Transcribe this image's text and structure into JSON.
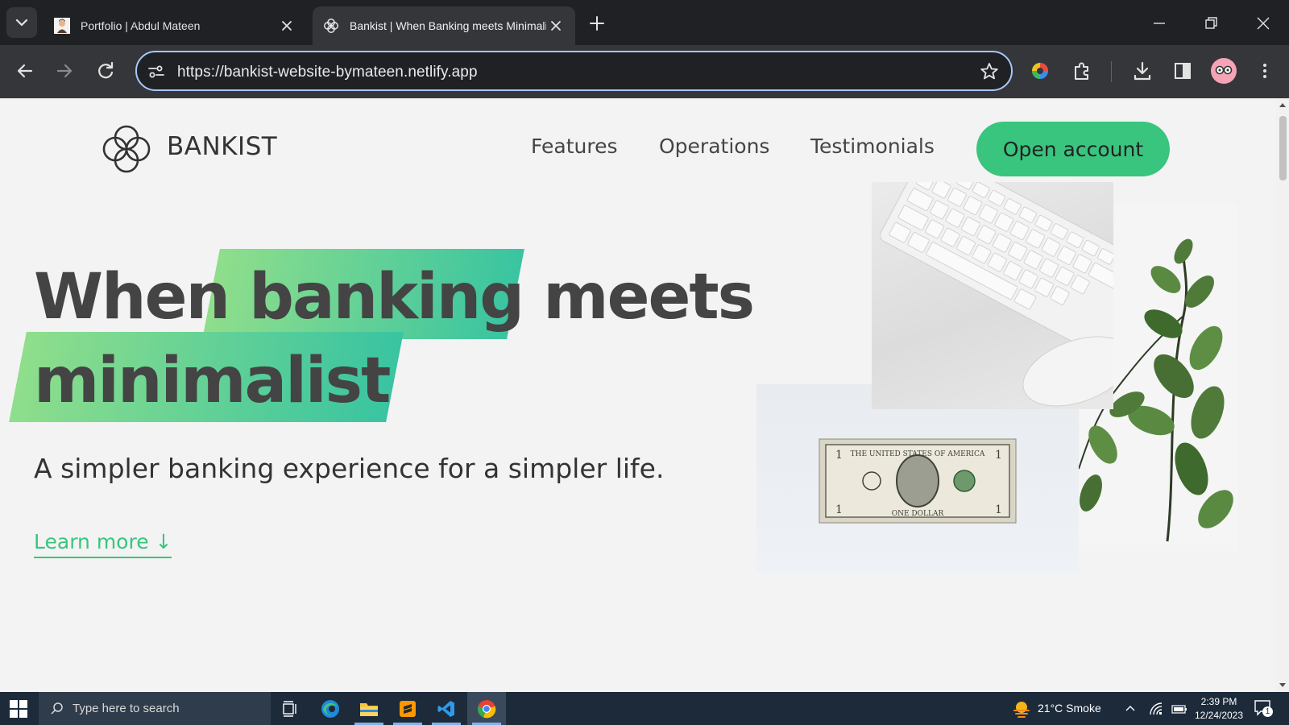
{
  "browser": {
    "tabs": [
      {
        "title": "Portfolio | Abdul Mateen",
        "active": false
      },
      {
        "title": "Bankist | When Banking meets Minimalist",
        "active": true
      }
    ],
    "url": "https://bankist-website-bymateen.netlify.app"
  },
  "site": {
    "brand": "BANKIST",
    "nav": [
      "Features",
      "Operations",
      "Testimonials"
    ],
    "cta": "Open account",
    "headline": {
      "word1": "When",
      "highlight1": "banking",
      "word2": "meets",
      "highlight2": "minimalist"
    },
    "subheading": "A simpler banking experience for a simpler life.",
    "learn_more": "Learn more ↓",
    "accent_color": "#39c57e"
  },
  "taskbar": {
    "search_placeholder": "Type here to search",
    "weather": "21°C  Smoke",
    "time": "2:39 PM",
    "date": "12/24/2023",
    "notifications": "1"
  }
}
